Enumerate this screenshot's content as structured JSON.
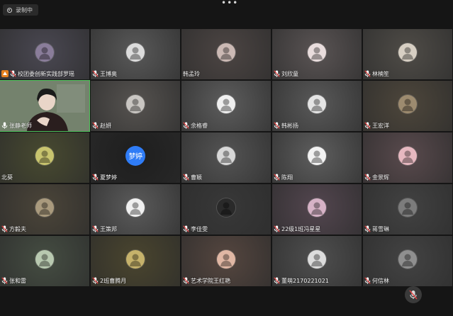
{
  "topbar": {
    "recording_label": "录制中",
    "more_icon": "more-dots-icon"
  },
  "colors": {
    "background": "#151515",
    "speaking_outline": "#4ec15a",
    "host_badge": "#e4801f",
    "text_avatar": "#2f7cf6",
    "muted_icon": "#e64545"
  },
  "participants": [
    {
      "name": "校团委创新实践部罗瑶",
      "mic": "muted",
      "host": true,
      "avatar_color": "#8a7d9a",
      "tile_color": "#4a4852"
    },
    {
      "name": "王博奥",
      "mic": "muted",
      "avatar_color": "#dcdcdc",
      "tile_color": "#595959"
    },
    {
      "name": "韩孟玲",
      "mic": "none",
      "avatar_color": "#cbb9b4",
      "tile_color": "#4c4543"
    },
    {
      "name": "刘欣童",
      "mic": "muted",
      "avatar_color": "#e8dcdc",
      "tile_color": "#5a5454"
    },
    {
      "name": "林楠笙",
      "mic": "muted",
      "avatar_color": "#d7cfc3",
      "tile_color": "#4f4c47"
    },
    {
      "name": "张静老师",
      "mic": "on",
      "video": true,
      "tile_color": "#6c7866"
    },
    {
      "name": "赵妍",
      "mic": "muted",
      "avatar_color": "#c9c6c2",
      "tile_color": "#565350"
    },
    {
      "name": "余格睿",
      "mic": "muted",
      "avatar_color": "#efefef",
      "tile_color": "#5d5d5d"
    },
    {
      "name": "韩彬扬",
      "mic": "muted",
      "avatar_color": "#e4e4e4",
      "tile_color": "#595959"
    },
    {
      "name": "王宏洋",
      "mic": "muted",
      "avatar_color": "#9d8b6f",
      "tile_color": "#4d463b"
    },
    {
      "name": "北葵",
      "mic": "none",
      "avatar_color": "#c8c46e",
      "tile_color": "#484a30"
    },
    {
      "name": "夏梦婷",
      "mic": "muted",
      "text_avatar": "梦婷",
      "tile_color": "#1e1e1e"
    },
    {
      "name": "曹颖",
      "mic": "muted",
      "avatar_color": "#d8d8d8",
      "tile_color": "#545454"
    },
    {
      "name": "陈翔",
      "mic": "muted",
      "avatar_color": "#f2f2f2",
      "tile_color": "#5e5e5e"
    },
    {
      "name": "金景辉",
      "mic": "muted",
      "avatar_color": "#e6b8c0",
      "tile_color": "#594a4d"
    },
    {
      "name": "方毅夫",
      "mic": "muted",
      "avatar_color": "#a99a7d",
      "tile_color": "#4b4539"
    },
    {
      "name": "王策邦",
      "mic": "muted",
      "avatar_color": "#f0f0f0",
      "tile_color": "#5b5b5b"
    },
    {
      "name": "李佳雯",
      "mic": "muted",
      "avatar_color": "#2a2a2a",
      "tile_color": "#383838"
    },
    {
      "name": "22级1班冯星星",
      "mic": "muted",
      "avatar_color": "#d6b2c6",
      "tile_color": "#53464f"
    },
    {
      "name": "蒋雪琳",
      "mic": "muted",
      "avatar_color": "#7c7c7c",
      "tile_color": "#424242"
    },
    {
      "name": "张和雷",
      "mic": "muted",
      "avatar_color": "#b8c9b0",
      "tile_color": "#454d42"
    },
    {
      "name": "2班曹腾月",
      "mic": "muted",
      "avatar_color": "#c6b26b",
      "tile_color": "#4a452e"
    },
    {
      "name": "艺术学院王红艳",
      "mic": "muted",
      "avatar_color": "#e0b7a4",
      "tile_color": "#55463f"
    },
    {
      "name": "董萌2170221021",
      "mic": "muted",
      "avatar_color": "#dcdcdc",
      "tile_color": "#4f4f4f"
    },
    {
      "name": "何信林",
      "mic": "muted",
      "avatar_color": "#8f8f8f",
      "tile_color": "#434343"
    }
  ],
  "bottom": {
    "mic_icon": "muted-mic-icon"
  }
}
